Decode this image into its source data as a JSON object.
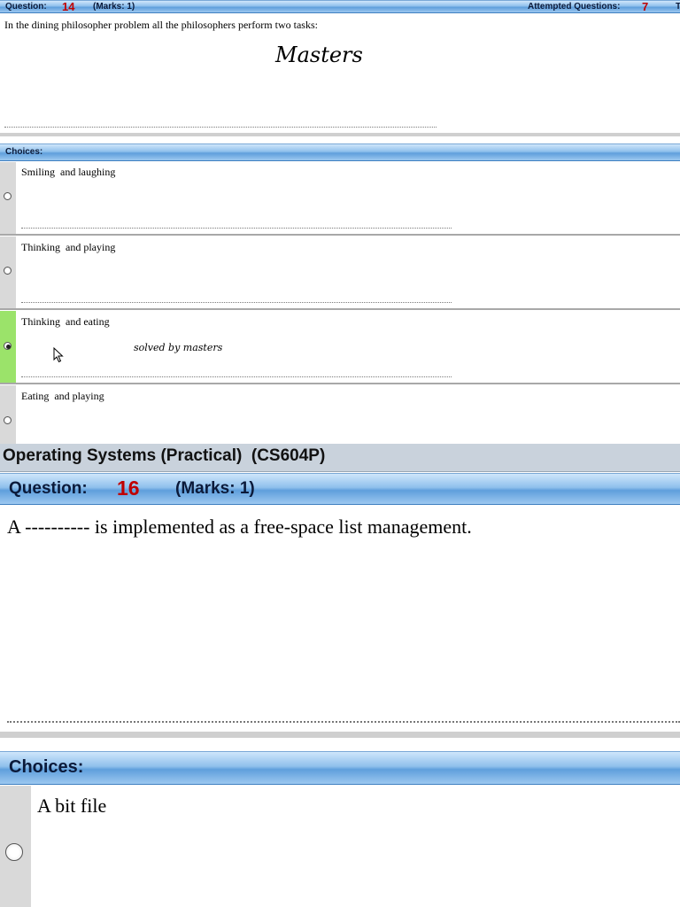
{
  "top_header": {
    "question_label": "Question:",
    "question_number": "14",
    "marks": "(Marks: 1)",
    "attempted_label": "Attempted Questions:",
    "attempted_count": "7",
    "cut_label": "T"
  },
  "q14": {
    "text": "In the dining philosopher problem all the philosophers perform two tasks:",
    "watermark": "Masters"
  },
  "choices_header": "Choices:",
  "q14_choices": [
    {
      "text": "Smiling  and laughing",
      "selected": false
    },
    {
      "text": "Thinking  and playing",
      "selected": false
    },
    {
      "text": "Thinking  and eating",
      "selected": true,
      "note": "solved by masters"
    },
    {
      "text": "Eating  and playing",
      "selected": false
    }
  ],
  "course_title": "Operating Systems (Practical)  (CS604P)",
  "bottom_header": {
    "question_label": "Question:",
    "question_number": "16",
    "marks": "(Marks: 1)"
  },
  "q16": {
    "text": "A ---------- is implemented as a free-space list management."
  },
  "bottom_choices_header": "Choices:",
  "q16_choices": [
    {
      "text": "A bit file",
      "selected": false
    }
  ],
  "colors": {
    "header_blue": "#7fb4e6",
    "selected_green": "#9be36a",
    "number_red": "#c00000"
  }
}
